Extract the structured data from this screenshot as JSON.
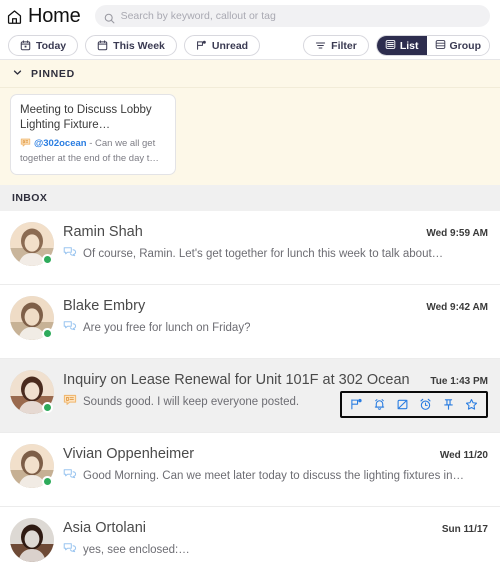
{
  "header": {
    "home_label": "Home",
    "home_icon": "home-icon",
    "search_icon": "search-icon",
    "search_placeholder": "Search by keyword, callout or tag",
    "search_value": ""
  },
  "filterbar": {
    "chips": [
      {
        "label": "Today",
        "icon": "calendar-today-icon"
      },
      {
        "label": "This Week",
        "icon": "calendar-week-icon"
      },
      {
        "label": "Unread",
        "icon": "unread-flag-icon"
      }
    ],
    "filter_label": "Filter",
    "filter_icon": "filter-icon",
    "views": [
      {
        "label": "List",
        "icon": "list-view-icon",
        "active": true
      },
      {
        "label": "Group",
        "icon": "group-view-icon",
        "active": false
      }
    ]
  },
  "pinned": {
    "section_label": "PINNED",
    "chevron_icon": "chevron-down-icon",
    "card": {
      "title": "Meeting to Discuss Lobby Lighting Fixture…",
      "icon": "message-card-icon",
      "tag": "@302ocean",
      "snippet": " - Can we all get together at the end of the day t…"
    }
  },
  "inbox": {
    "section_label": "INBOX",
    "accent_blue": "#2a7de1",
    "selected_bg": "#f0f0f0",
    "online_color": "#2eab5b",
    "rows": [
      {
        "name": "Ramin Shah",
        "time": "Wed 9:59 AM",
        "snippet": "Of course, Ramin. Let's get together for lunch this week to talk about…",
        "icon": "chat-bubbles-icon",
        "online": true,
        "selected": false
      },
      {
        "name": "Blake Embry",
        "time": "Wed 9:42 AM",
        "snippet": "Are you free for lunch on Friday?",
        "icon": "chat-bubbles-icon",
        "online": true,
        "selected": false
      },
      {
        "name": "Inquiry on Lease Renewal for Unit 101F at 302 Ocean",
        "time": "Tue 1:43 PM",
        "snippet": "Sounds good. I will keep everyone posted.",
        "icon": "message-card-icon",
        "online": true,
        "selected": true
      },
      {
        "name": "Vivian Oppenheimer",
        "time": "Wed 11/20",
        "snippet": "Good Morning. Can we meet later today to discuss the lighting fixtures in…",
        "icon": "chat-bubbles-icon",
        "online": true,
        "selected": false
      },
      {
        "name": "Asia Ortolani",
        "time": "Sun 11/17",
        "snippet": "yes, see enclosed:…",
        "icon": "chat-bubbles-icon",
        "online": false,
        "selected": false
      }
    ]
  },
  "row_actions": [
    {
      "name": "mark-unread-action",
      "icon": "unread-flag-icon"
    },
    {
      "name": "notify-action",
      "icon": "bell-icon"
    },
    {
      "name": "mute-action",
      "icon": "mute-icon"
    },
    {
      "name": "snooze-action",
      "icon": "alarm-clock-icon"
    },
    {
      "name": "pin-action",
      "icon": "pin-icon"
    },
    {
      "name": "favorite-action",
      "icon": "star-icon"
    }
  ]
}
